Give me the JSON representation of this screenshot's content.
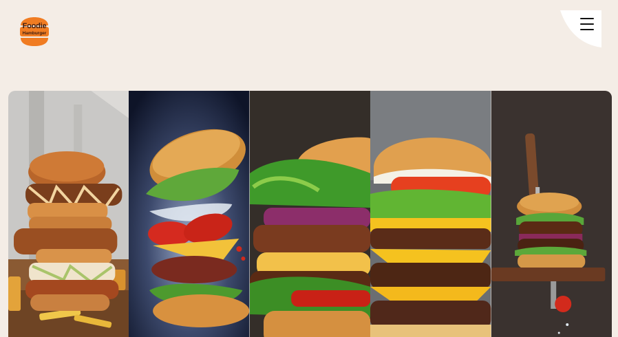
{
  "header": {
    "logo_line1": "Foodie",
    "logo_line2": "Hamburger",
    "menu_icon": "hamburger-menu-icon"
  },
  "colors": {
    "background": "#f4ede6",
    "brand_orange": "#f07c22",
    "logo_text": "#3b1d12"
  },
  "gallery": {
    "panels": [
      {
        "name": "stacked-fried-chicken-burger"
      },
      {
        "name": "floating-deconstructed-burger"
      },
      {
        "name": "closeup-lettuce-burger"
      },
      {
        "name": "double-cheeseburger"
      },
      {
        "name": "burger-on-knife-board"
      }
    ]
  }
}
